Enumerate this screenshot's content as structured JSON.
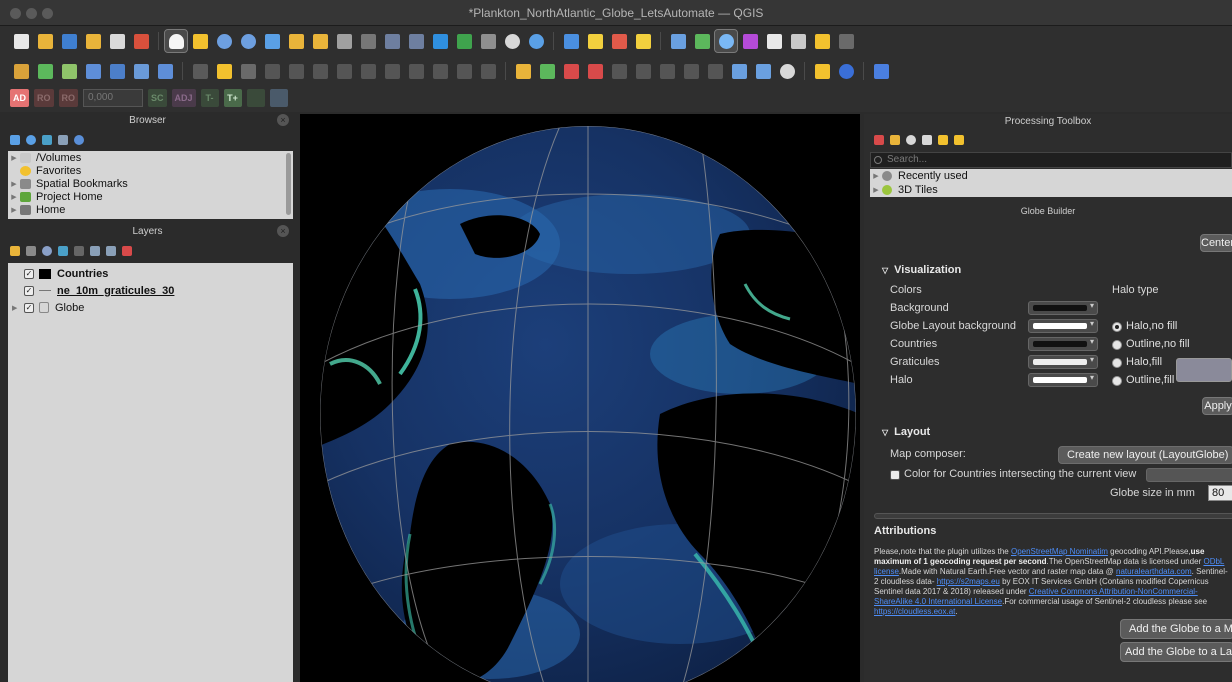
{
  "window": {
    "title": "*Plankton_NorthAtlantic_Globe_LetsAutomate — QGIS"
  },
  "advanced_digitizing": {
    "buttons": [
      "AD",
      "RO",
      "RO",
      "SC",
      "ADJ",
      "T-",
      "T+"
    ],
    "value": "0,000"
  },
  "browser": {
    "title": "Browser",
    "items": [
      {
        "label": "/Volumes",
        "icon": "folder-icon",
        "color": "#c9c9c9"
      },
      {
        "label": "Favorites",
        "icon": "star-icon",
        "color": "#f2c12e"
      },
      {
        "label": "Spatial Bookmarks",
        "icon": "bookmark-icon",
        "color": "#8a8a8a"
      },
      {
        "label": "Project Home",
        "icon": "project-home-icon",
        "color": "#5ea63b"
      },
      {
        "label": "Home",
        "icon": "home-icon",
        "color": "#777777"
      }
    ]
  },
  "layers": {
    "title": "Layers",
    "items": [
      {
        "label": "Countries",
        "checked": true,
        "bold": true
      },
      {
        "label": "ne_10m_graticules_30",
        "checked": true,
        "bold": true
      },
      {
        "label": "Globe",
        "checked": true,
        "bold": false
      }
    ]
  },
  "processing": {
    "title": "Processing Toolbox",
    "search_placeholder": "Search...",
    "items": [
      {
        "label": "Recently used",
        "color": "#8a8a8a"
      },
      {
        "label": "3D Tiles",
        "color": "#9bc53d"
      }
    ]
  },
  "globe_builder": {
    "title": "Globe Builder",
    "center_button": "Center",
    "visualization_heading": "Visualization",
    "colors_label": "Colors",
    "halo_type_label": "Halo type",
    "color_rows": [
      {
        "label": "Background",
        "swatch": "#111111"
      },
      {
        "label": "Globe Layout background",
        "swatch": "#ffffff"
      },
      {
        "label": "Countries",
        "swatch": "#111111"
      },
      {
        "label": "Graticules",
        "swatch": "#f0f0f0"
      },
      {
        "label": "Halo",
        "swatch": "#ffffff"
      }
    ],
    "halo_options": [
      {
        "label": "Halo,no fill",
        "selected": true
      },
      {
        "label": "Outline,no fill",
        "selected": false
      },
      {
        "label": "Halo,fill",
        "selected": false
      },
      {
        "label": "Outline,fill",
        "selected": false
      }
    ],
    "apply_button": "Apply",
    "layout_heading": "Layout",
    "map_composer_label": "Map composer:",
    "map_composer_value": "Create new layout (LayoutGlobe)",
    "color_countries_label": "Color for Countries intersecting the current view",
    "globe_size_label": "Globe size in mm",
    "globe_size_value": "80",
    "attributions_heading": "Attributions",
    "add_map_button": "Add the Globe to a Map",
    "add_layout_button": "Add the Globe to a Layout"
  }
}
